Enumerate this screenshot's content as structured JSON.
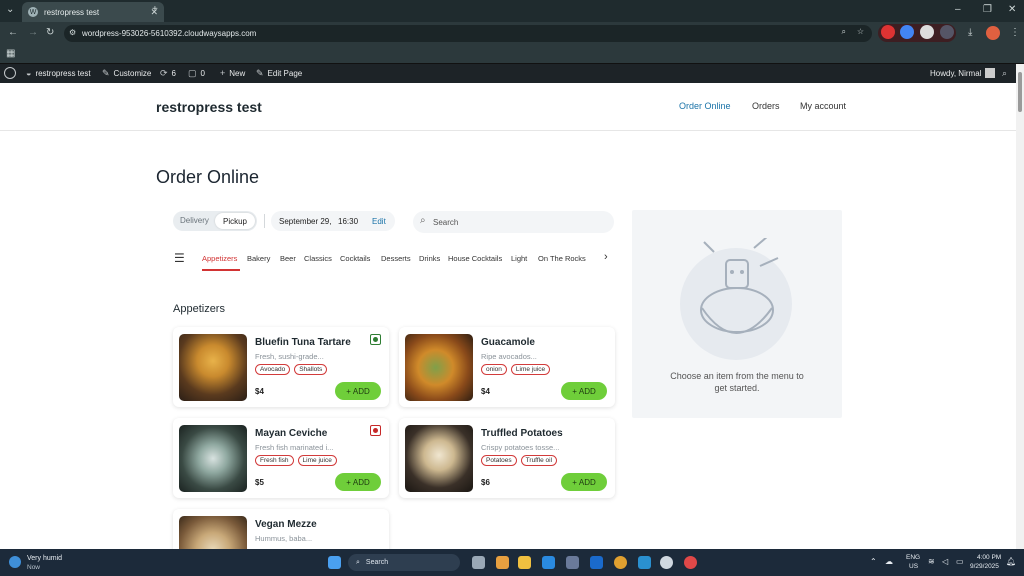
{
  "browser": {
    "tab_title": "restropress test",
    "url": "wordpress-953026-5610392.cloudwaysapps.com"
  },
  "wpbar": {
    "site": "restropress test",
    "customize": "Customize",
    "updates_count": "6",
    "comments_count": "0",
    "new": "New",
    "edit_page": "Edit Page",
    "howdy": "Howdy, Nirmal"
  },
  "site": {
    "title": "restropress test",
    "nav": [
      "Order Online",
      "Orders",
      "My account"
    ]
  },
  "page": {
    "heading": "Order Online",
    "delivery": "Delivery",
    "pickup": "Pickup",
    "date": "September 29,",
    "time": "16:30",
    "edit": "Edit",
    "search_placeholder": "Search",
    "categories": [
      "Appetizers",
      "Bakery",
      "Beer",
      "Classics",
      "Cocktails",
      "Desserts",
      "Drinks",
      "House Cocktails",
      "Light",
      "On The Rocks"
    ],
    "section_title": "Appetizers",
    "add_label": "ADD"
  },
  "items": [
    {
      "name": "Bluefin Tuna Tartare",
      "desc": "Fresh, sushi-grade...",
      "tags": [
        "Avocado",
        "Shallots"
      ],
      "price": "$4"
    },
    {
      "name": "Guacamole",
      "desc": "Ripe avocados...",
      "tags": [
        "onion",
        "Lime juice"
      ],
      "price": "$4"
    },
    {
      "name": "Mayan Ceviche",
      "desc": "Fresh fish marinated i...",
      "tags": [
        "Fresh fish",
        "Lime juice"
      ],
      "price": "$5"
    },
    {
      "name": "Truffled Potatoes",
      "desc": "Crispy potatoes tosse...",
      "tags": [
        "Potatoes",
        "Truffle oil"
      ],
      "price": "$6"
    },
    {
      "name": "Vegan Mezze",
      "desc": "Hummus, baba..."
    }
  ],
  "cart": {
    "message_line1": "Choose an item from the menu to",
    "message_line2": "get started."
  },
  "taskbar": {
    "weather_title": "Very humid",
    "weather_sub": "Now",
    "search": "Search",
    "lang1": "ENG",
    "lang2": "US",
    "time": "4:00 PM",
    "date": "9/29/2025"
  },
  "colors": {
    "accent_red": "#d23333",
    "add_green": "#6fce3a",
    "nav_active": "#1a73a8"
  }
}
